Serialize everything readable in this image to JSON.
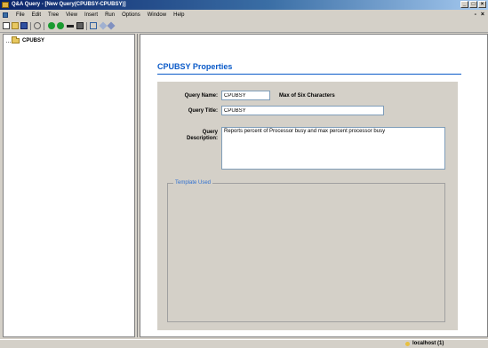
{
  "window": {
    "title": "Q&A Query - [New Query(CPUBSY-CPUBSY)]"
  },
  "menu": {
    "items": [
      "File",
      "Edit",
      "Tree",
      "View",
      "Insert",
      "Run",
      "Options",
      "Window",
      "Help"
    ],
    "mdi_minimize": "-",
    "mdi_restore": "×"
  },
  "toolbar": {
    "icons": [
      "new-icon",
      "open-icon",
      "save-icon",
      "back-icon",
      "run-icon",
      "stop-icon",
      "minus-icon",
      "print-icon",
      "find-icon",
      "link-icon",
      "options-icon"
    ]
  },
  "tree": {
    "root_label": "CPUBSY"
  },
  "properties": {
    "heading": "CPUBSY Properties",
    "query_name_label": "Query Name:",
    "query_name_value": "CPUBSY",
    "query_name_hint": "Max of Six Characters",
    "query_title_label": "Query Title:",
    "query_title_value": "CPUBSY",
    "query_description_label_line1": "Query",
    "query_description_label_line2": "Description:",
    "query_description_value": "Reports percent of Processor busy and max percent processor busy",
    "template_group_title": "Template Used"
  },
  "status": {
    "connection": "localhost (1)"
  },
  "colors": {
    "heading_blue": "#0a5ac8",
    "panel_grey": "#d4d0c8"
  }
}
